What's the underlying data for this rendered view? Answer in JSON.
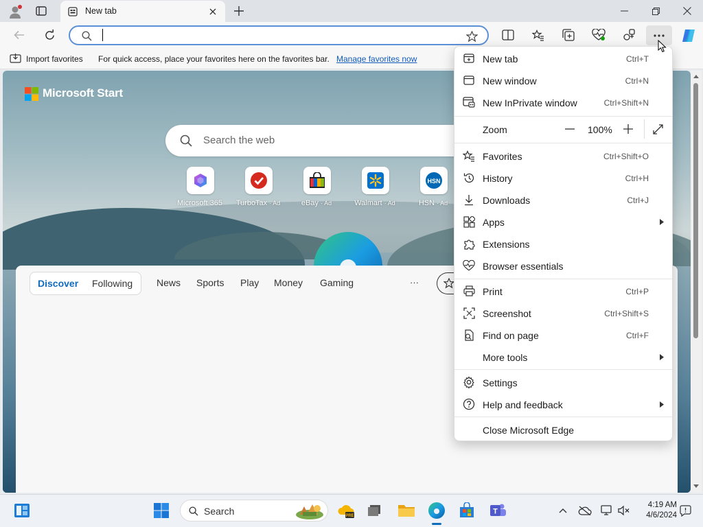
{
  "browser": {
    "tab_title": "New tab",
    "address_value": "",
    "address_placeholder": ""
  },
  "favorites_bar": {
    "import_label": "Import favorites",
    "message": "For quick access, place your favorites here on the favorites bar.",
    "manage_link": "Manage favorites now"
  },
  "ntp": {
    "brand": "Microsoft Start",
    "search_placeholder": "Search the web",
    "quick_links": [
      {
        "label": "Microsoft 365",
        "ad": ""
      },
      {
        "label": "TurboTax",
        "ad": "· Ad"
      },
      {
        "label": "eBay",
        "ad": "· Ad"
      },
      {
        "label": "Walmart",
        "ad": "· Ad"
      },
      {
        "label": "HSN",
        "ad": "· Ad"
      }
    ],
    "feed_tabs": [
      "Discover",
      "Following"
    ],
    "feed_nav": [
      "News",
      "Sports",
      "Play",
      "Money",
      "Gaming"
    ],
    "more": "···"
  },
  "menu": {
    "items": [
      {
        "label": "New tab",
        "shortcut": "Ctrl+T",
        "icon": "new-tab-icon"
      },
      {
        "label": "New window",
        "shortcut": "Ctrl+N",
        "icon": "new-window-icon"
      },
      {
        "label": "New InPrivate window",
        "shortcut": "Ctrl+Shift+N",
        "icon": "inprivate-icon"
      },
      {
        "label": "Zoom",
        "icon": ""
      },
      {
        "label": "Favorites",
        "shortcut": "Ctrl+Shift+O",
        "icon": "favorites-icon"
      },
      {
        "label": "History",
        "shortcut": "Ctrl+H",
        "icon": "history-icon"
      },
      {
        "label": "Downloads",
        "shortcut": "Ctrl+J",
        "icon": "download-icon"
      },
      {
        "label": "Apps",
        "icon": "apps-icon"
      },
      {
        "label": "Extensions",
        "icon": "extensions-icon"
      },
      {
        "label": "Browser essentials",
        "icon": "heart-pulse-icon"
      },
      {
        "label": "Print",
        "shortcut": "Ctrl+P",
        "icon": "print-icon"
      },
      {
        "label": "Screenshot",
        "shortcut": "Ctrl+Shift+S",
        "icon": "screenshot-icon"
      },
      {
        "label": "Find on page",
        "shortcut": "Ctrl+F",
        "icon": "find-icon"
      },
      {
        "label": "More tools",
        "icon": ""
      },
      {
        "label": "Settings",
        "icon": "gear-icon"
      },
      {
        "label": "Help and feedback",
        "icon": "help-icon"
      },
      {
        "label": "Close Microsoft Edge",
        "icon": ""
      }
    ],
    "zoom_level": "100%",
    "zoom_minus": "—",
    "zoom_plus": "+"
  },
  "taskbar": {
    "search_placeholder": "Search",
    "time": "4:19 AM",
    "date": "4/6/2024"
  },
  "colors": {
    "accent": "#0f6cbd",
    "link": "#0f5bb8",
    "taskbar_bg": "#eef1f5"
  }
}
